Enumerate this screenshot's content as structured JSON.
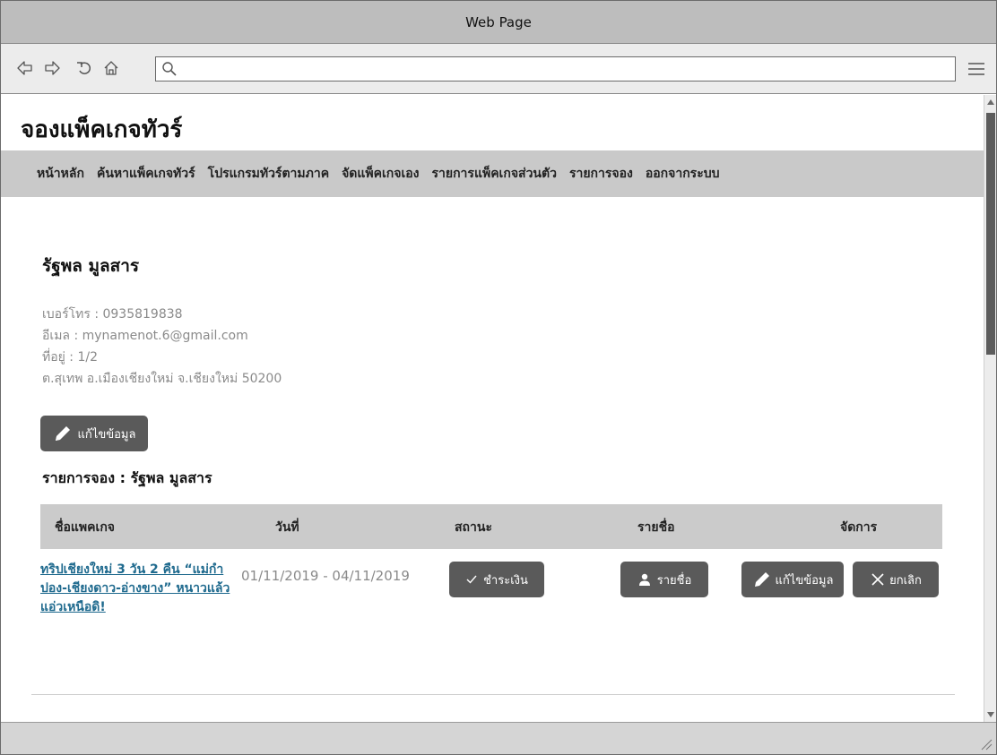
{
  "window": {
    "title": "Web Page"
  },
  "browser": {
    "address_value": "",
    "address_placeholder": ""
  },
  "site": {
    "title": "จองแพ็คเกจทัวร์",
    "nav": [
      "หน้าหลัก",
      "ค้นหาแพ็คเกจทัวร์",
      "โปรแกรมทัวร์ตามภาค",
      "จัดแพ็คเกจเอง",
      "รายการแพ็คเกจส่วนตัว",
      "รายการจอง",
      "ออกจากระบบ"
    ]
  },
  "profile": {
    "name": "รัฐพล มูลสาร",
    "phone": "เบอร์โทร : 0935819838",
    "email": "อีเมล : mynamenot.6@gmail.com",
    "address_line1": "ที่อยู่ : 1/2",
    "address_line2": "ต.สุเทพ อ.เมืองเชียงใหม่ จ.เชียงใหม่ 50200",
    "edit_label": "แก้ไขข้อมูล"
  },
  "bookings": {
    "heading": "รายการจอง : รัฐพล มูลสาร",
    "columns": [
      "ชื่อแพคเกจ",
      "วันที่",
      "สถานะ",
      "รายชื่อ",
      "จัดการ"
    ],
    "rows": [
      {
        "package": "ทริปเชียงใหม่ 3 วัน 2 คืน “แม่กำปอง-เชียงดาว-อ่างขาง” หนาวแล้ว แอ่วเหนือดิ!",
        "date": "01/11/2019 - 04/11/2019",
        "status": "ชำระเงิน",
        "names": "รายชื่อ",
        "edit": "แก้ไขข้อมูล",
        "cancel": "ยกเลิก"
      }
    ]
  },
  "colors": {
    "link": "#1f6a8e",
    "button": "#5a5a5a",
    "nav_bg": "#c9c9c9"
  }
}
